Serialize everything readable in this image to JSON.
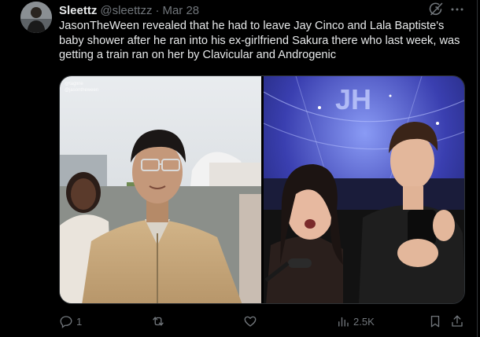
{
  "tweet": {
    "display_name": "Sleettz",
    "handle": "@sleettzz",
    "separator": "·",
    "date": "Mar 28",
    "text": "JasonTheWeen revealed that he had to leave Jay Cinco and Lala Baptiste's baby shower after he ran into his ex-girlfriend Sakura there who last week, was getting a train ran on her by Clavicular and Androgenic",
    "media": {
      "watermark_line1": "@tagline",
      "watermark_line2": "@jasontheween",
      "sign_text": "JH"
    }
  },
  "actions": {
    "reply_count": "1",
    "retweet_count": "",
    "like_count": "",
    "views_count": "2.5K"
  },
  "icons": {
    "more": "more-icon",
    "grok": "grok-icon",
    "reply": "reply-icon",
    "retweet": "retweet-icon",
    "like": "like-icon",
    "views": "views-icon",
    "bookmark": "bookmark-icon",
    "share": "share-icon"
  },
  "colors": {
    "background": "#000000",
    "text": "#e7e9ea",
    "muted": "#71767b",
    "border": "#2f3336"
  }
}
